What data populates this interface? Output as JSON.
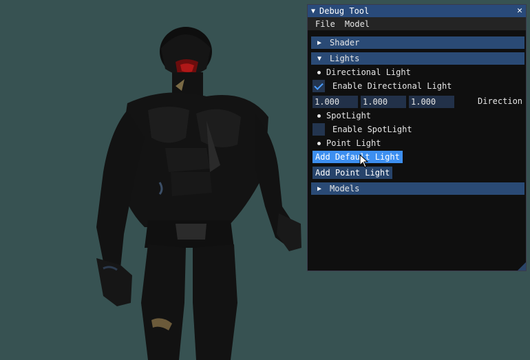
{
  "window": {
    "title": "Debug Tool",
    "close_glyph": "✕"
  },
  "menu": {
    "items": [
      "File",
      "Model"
    ]
  },
  "sections": {
    "shader": {
      "label": "Shader",
      "expanded": false
    },
    "lights": {
      "label": "Lights",
      "expanded": true
    },
    "models": {
      "label": "Models",
      "expanded": false
    }
  },
  "lights": {
    "directional": {
      "label": "Directional Light",
      "enable_label": "Enable Directional Light",
      "enabled": true,
      "direction": [
        "1.000",
        "1.000",
        "1.000"
      ],
      "direction_label": "Direction"
    },
    "spot": {
      "label": "SpotLight",
      "enable_label": "Enable SpotLight",
      "enabled": false
    },
    "point": {
      "label": "Point Light"
    },
    "buttons": {
      "add_default": "Add Default Light",
      "add_point": "Add Point Light"
    }
  },
  "icons": {
    "collapse": "triangle-down-icon",
    "expand": "triangle-right-icon",
    "close": "close-icon",
    "cursor": "mouse-pointer-icon"
  },
  "colors": {
    "background": "#375252",
    "title_bar": "#294a7a",
    "header": "#2a4a75",
    "button_active": "#3d8ff0",
    "button": "#27446b",
    "frame": "#223149",
    "check": "#4a9dff"
  }
}
